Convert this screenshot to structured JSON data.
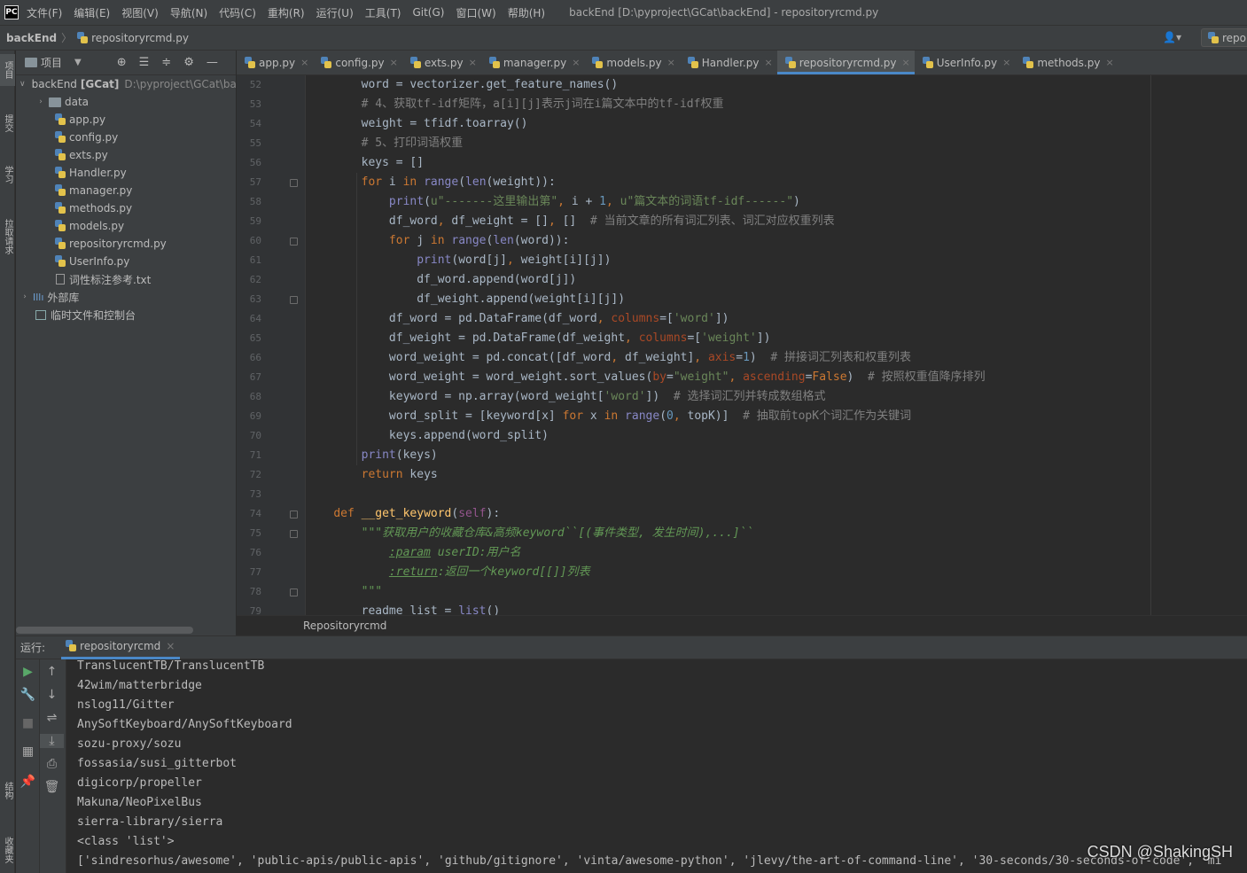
{
  "menubar": {
    "items": [
      "文件(F)",
      "编辑(E)",
      "视图(V)",
      "导航(N)",
      "代码(C)",
      "重构(R)",
      "运行(U)",
      "工具(T)",
      "Git(G)",
      "窗口(W)",
      "帮助(H)"
    ],
    "window_title": "backEnd [D:\\pyproject\\GCat\\backEnd] - repositoryrcmd.py"
  },
  "navbar": {
    "project": "backEnd",
    "file": "repositoryrcmd.py",
    "run_config": "repo"
  },
  "left_toolbar": {
    "labels": [
      "项目",
      "提交",
      "学习",
      "拉取请求"
    ],
    "bottom_labels": [
      "结构",
      "收藏夹"
    ]
  },
  "project_panel": {
    "title": "项目",
    "root": {
      "name": "backEnd",
      "module": "[GCat]",
      "path": "D:\\pyproject\\GCat\\backEnd"
    },
    "items": [
      "data",
      "app.py",
      "config.py",
      "exts.py",
      "Handler.py",
      "manager.py",
      "methods.py",
      "models.py",
      "repositoryrcmd.py",
      "UserInfo.py",
      "词性标注参考.txt"
    ],
    "external": "外部库",
    "scratches": "临时文件和控制台"
  },
  "editor_tabs": [
    "app.py",
    "config.py",
    "exts.py",
    "manager.py",
    "models.py",
    "Handler.py",
    "repositoryrcmd.py",
    "UserInfo.py",
    "methods.py"
  ],
  "active_tab_index": 6,
  "line_numbers": [
    "52",
    "53",
    "54",
    "55",
    "56",
    "57",
    "58",
    "59",
    "60",
    "61",
    "62",
    "63",
    "64",
    "65",
    "66",
    "67",
    "68",
    "69",
    "70",
    "71",
    "72",
    "73",
    "74",
    "75",
    "76",
    "77",
    "78",
    "79"
  ],
  "code_lines": [
    "        word = vectorizer.get_feature_names()",
    "        # 4、获取tf-idf矩阵，a[i][j]表示j词在i篇文本中的tf-idf权重",
    "        weight = tfidf.toarray()",
    "        # 5、打印词语权重",
    "        keys = []",
    "        for i in range(len(weight)):",
    "            print(u\"-------这里输出第\", i + 1, u\"篇文本的词语tf-idf------\")",
    "            df_word, df_weight = [], []  # 当前文章的所有词汇列表、词汇对应权重列表",
    "            for j in range(len(word)):",
    "                print(word[j], weight[i][j])",
    "                df_word.append(word[j])",
    "                df_weight.append(weight[i][j])",
    "            df_word = pd.DataFrame(df_word, columns=['word'])",
    "            df_weight = pd.DataFrame(df_weight, columns=['weight'])",
    "            word_weight = pd.concat([df_word, df_weight], axis=1)  # 拼接词汇列表和权重列表",
    "            word_weight = word_weight.sort_values(by=\"weight\", ascending=False)  # 按照权重值降序排列",
    "            keyword = np.array(word_weight['word'])  # 选择词汇列并转成数组格式",
    "            word_split = [keyword[x] for x in range(0, topK)]  # 抽取前topK个词汇作为关键词",
    "            keys.append(word_split)",
    "        print(keys)",
    "        return keys",
    "",
    "    def __get_keyword(self):",
    "        \"\"\"获取用户的收藏仓库&高频keyword``[(事件类型, 发生时间),...]``",
    "            :param userID:用户名",
    "            :return:返回一个keyword[[]]列表",
    "        \"\"\"",
    "        readme_list = list()"
  ],
  "breadcrumb": "Repositoryrcmd",
  "run_panel": {
    "label": "运行:",
    "tab": "repositoryrcmd"
  },
  "console_lines": [
    "TranslucentTB/TranslucentTB",
    "42wim/matterbridge",
    "nslog11/Gitter",
    "AnySoftKeyboard/AnySoftKeyboard",
    "sozu-proxy/sozu",
    "fossasia/susi_gitterbot",
    "digicorp/propeller",
    "Makuna/NeoPixelBus",
    "sierra-library/sierra",
    "<class 'list'>",
    "['sindresorhus/awesome', 'public-apis/public-apis', 'github/gitignore', 'vinta/awesome-python', 'jlevy/the-art-of-command-line', '30-seconds/30-seconds-of-code', 'mi"
  ],
  "watermark": "CSDN @ShakingSH",
  "colors": {
    "accent": "#4a88c7",
    "keyword": "#cc7832",
    "string": "#6a8759",
    "comment": "#808080",
    "number": "#6897bb"
  }
}
